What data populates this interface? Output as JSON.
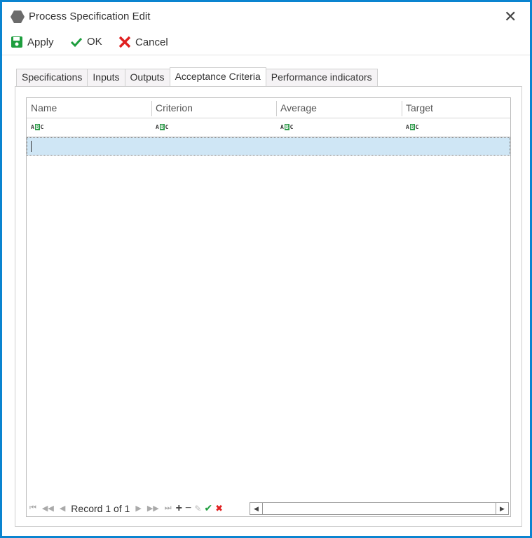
{
  "window": {
    "title": "Process Specification Edit"
  },
  "toolbar": {
    "apply": "Apply",
    "ok": "OK",
    "cancel": "Cancel"
  },
  "tabs": [
    {
      "label": "Specifications"
    },
    {
      "label": "Inputs"
    },
    {
      "label": "Outputs"
    },
    {
      "label": "Acceptance Criteria",
      "active": true
    },
    {
      "label": "Performance indicators"
    }
  ],
  "grid": {
    "columns": [
      "Name",
      "Criterion",
      "Average",
      "Target"
    ]
  },
  "navigator": {
    "record_text": "Record 1 of 1"
  },
  "colors": {
    "border": "#0a84d0",
    "selected_row": "#cfe6f5",
    "apply": "#1e9e3e",
    "ok": "#1e9e3e",
    "cancel": "#e02020"
  }
}
